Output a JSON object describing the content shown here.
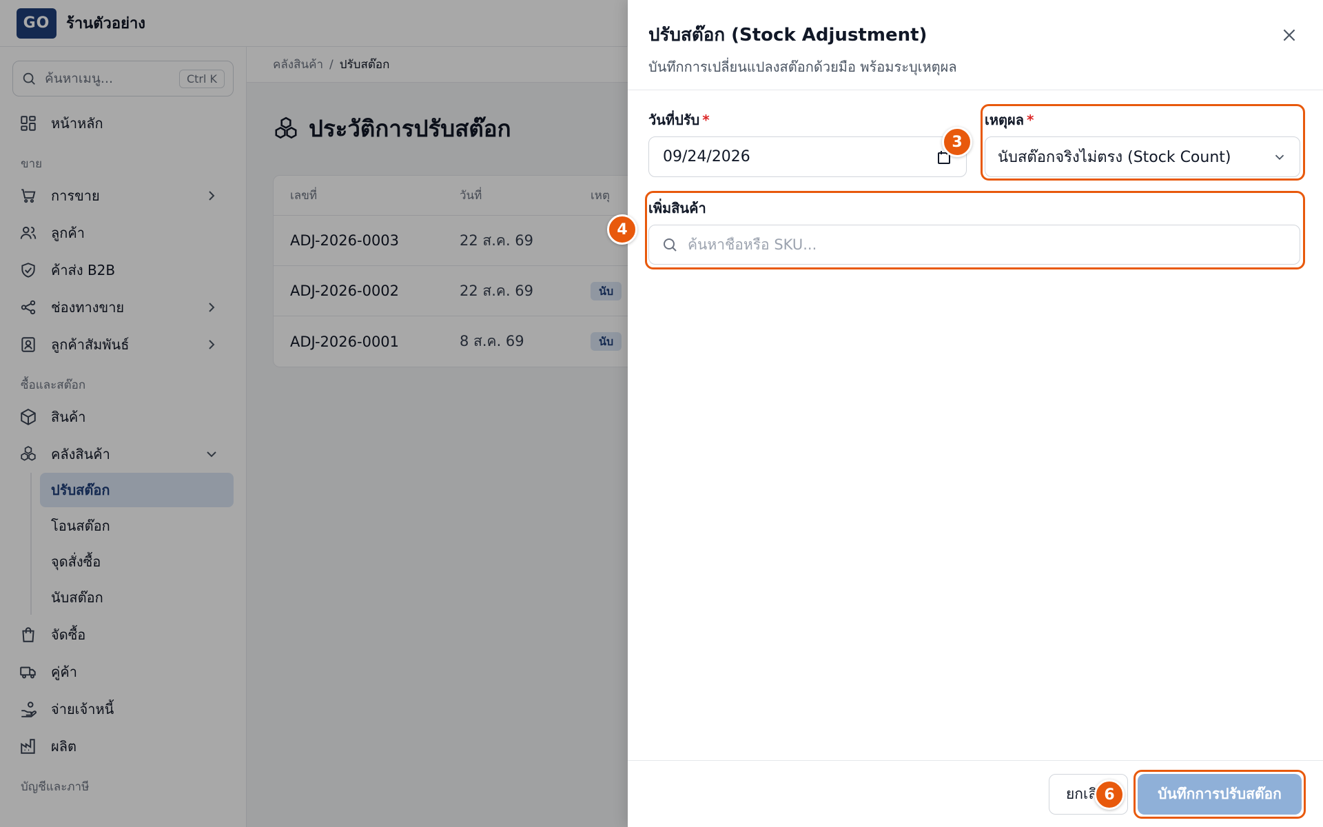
{
  "app": {
    "logo": "GO",
    "store_name": "ร้านตัวอย่าง"
  },
  "sidebar": {
    "search_placeholder": "ค้นหาเมนู...",
    "search_shortcut": "Ctrl K",
    "home": "หน้าหลัก",
    "section_sales": "ขาย",
    "sales_items": [
      "การขาย",
      "ลูกค้า",
      "ค้าส่ง B2B",
      "ช่องทางขาย",
      "ลูกค้าสัมพันธ์"
    ],
    "section_purchase": "ซื้อและสต๊อก",
    "product": "สินค้า",
    "warehouse": "คลังสินค้า",
    "warehouse_sub": [
      "ปรับสต๊อก",
      "โอนสต๊อก",
      "จุดสั่งซื้อ",
      "นับสต๊อก"
    ],
    "more_items": [
      "จัดซื้อ",
      "คู่ค้า",
      "จ่ายเจ้าหนี้",
      "ผลิต"
    ],
    "section_accounting": "บัญชีและภาษี"
  },
  "breadcrumb": {
    "parent": "คลังสินค้า",
    "separator": "/",
    "current": "ปรับสต๊อก"
  },
  "page": {
    "title": "ประวัติการปรับสต๊อก"
  },
  "table": {
    "headers": [
      "เลขที่",
      "วันที่",
      "เหตุ"
    ],
    "rows": [
      {
        "no": "ADJ-2026-0003",
        "date": "22 ส.ค. 69",
        "reason": ""
      },
      {
        "no": "ADJ-2026-0002",
        "date": "22 ส.ค. 69",
        "reason": "นับ"
      },
      {
        "no": "ADJ-2026-0001",
        "date": "8 ส.ค. 69",
        "reason": "นับ"
      }
    ]
  },
  "drawer": {
    "title": "ปรับสต๊อก (Stock Adjustment)",
    "subtitle": "บันทึกการเปลี่ยนแปลงสต๊อกด้วยมือ พร้อมระบุเหตุผล",
    "date_label": "วันที่ปรับ",
    "date_value": "09/24/2026",
    "reason_label": "เหตุผล",
    "reason_value": "นับสต๊อกจริงไม่ตรง (Stock Count)",
    "required_mark": "*",
    "add_product_label": "เพิ่มสินค้า",
    "product_search_placeholder": "ค้นหาชื่อหรือ SKU...",
    "cancel_label": "ยกเลิก",
    "save_label": "บันทึกการปรับสต๊อก"
  },
  "annotations": {
    "step_reason": "3",
    "step_add_product": "4",
    "step_save": "6"
  },
  "colors": {
    "accent": "#e8590c",
    "brand": "#1f3f7a",
    "save_button": "#8fb0d8",
    "active_nav_bg": "#dbe6f5"
  }
}
